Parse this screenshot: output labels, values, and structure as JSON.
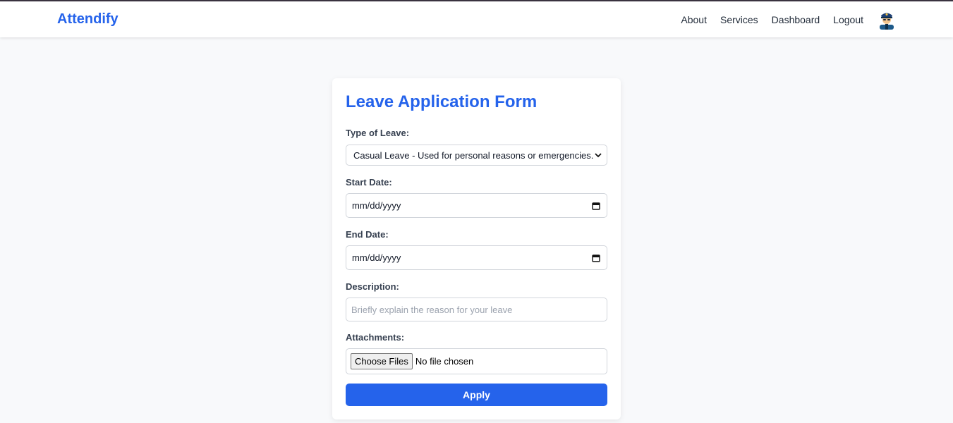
{
  "navbar": {
    "brand": "Attendify",
    "links": [
      "About",
      "Services",
      "Dashboard",
      "Logout"
    ],
    "avatar_icon": "police-officer-avatar-icon"
  },
  "form": {
    "title": "Leave Application Form",
    "leave_type": {
      "label": "Type of Leave:",
      "selected": "Casual Leave - Used for personal reasons or emergencies."
    },
    "start_date": {
      "label": "Start Date:",
      "value": "mm/dd/yyyy"
    },
    "end_date": {
      "label": "End Date:",
      "value": "mm/dd/yyyy"
    },
    "description": {
      "label": "Description:",
      "placeholder": "Briefly explain the reason for your leave"
    },
    "attachments": {
      "label": "Attachments:",
      "button": "Choose Files",
      "status": "No file chosen"
    },
    "submit": "Apply"
  },
  "colors": {
    "accent": "#2563eb",
    "background": "#f8f9fb"
  }
}
